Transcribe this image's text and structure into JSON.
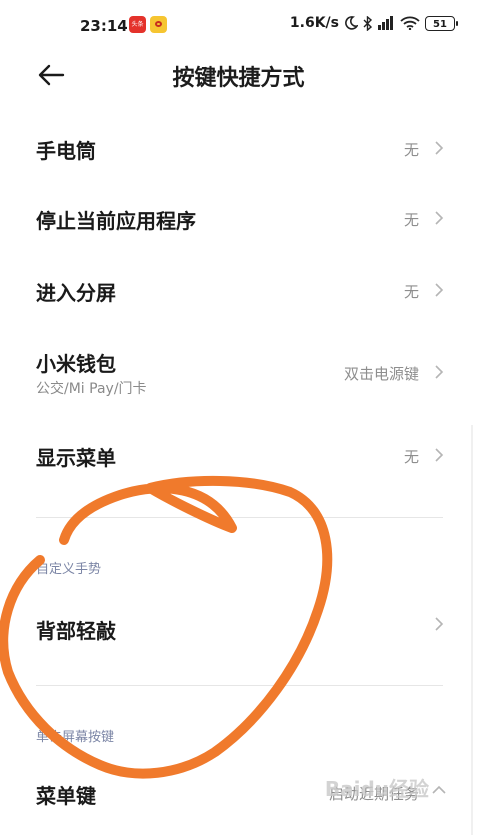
{
  "status_bar": {
    "time": "23:14",
    "net_speed": "1.6K/s",
    "battery": "51",
    "badge_red_text": "头条"
  },
  "header": {
    "title": "按键快捷方式",
    "back_icon": "back-arrow-icon"
  },
  "items": [
    {
      "label": "手电筒",
      "value": "无"
    },
    {
      "label": "停止当前应用程序",
      "value": "无"
    },
    {
      "label": "进入分屏",
      "value": "无"
    },
    {
      "label": "小米钱包",
      "subtitle": "公交/Mi Pay/门卡",
      "value": "双击电源键"
    },
    {
      "label": "显示菜单",
      "value": "无"
    }
  ],
  "section_gesture": {
    "header": "自定义手势",
    "items": [
      {
        "label": "背部轻敲",
        "value": ""
      }
    ]
  },
  "section_screen_keys": {
    "header": "单击屏幕按键",
    "items": [
      {
        "label": "菜单键",
        "value": "启动近期任务"
      }
    ]
  },
  "watermark": "Baidu经验",
  "colors": {
    "annotation_stroke": "#f07a2c",
    "section_header": "#7c86a6",
    "value_text": "#8e8e8e"
  }
}
